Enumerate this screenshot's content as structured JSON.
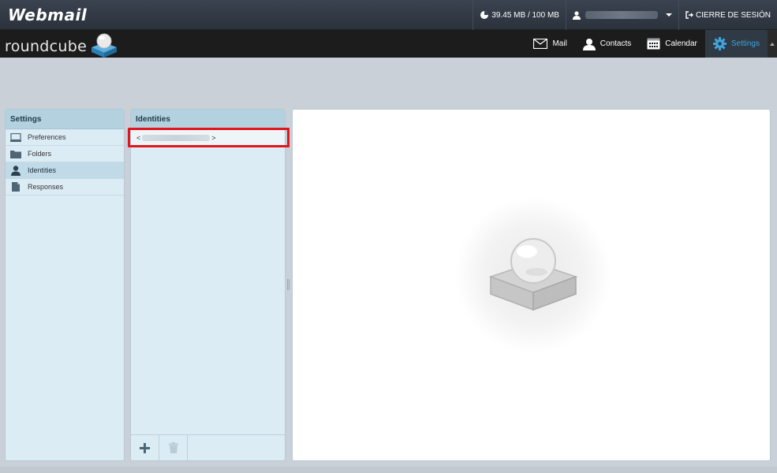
{
  "topbar": {
    "brand": "Webmail",
    "quota": "39.45 MB / 100 MB",
    "logout": "CIERRE DE SESIÓN"
  },
  "header": {
    "logo_text": "roundcube",
    "tasks": [
      {
        "label": "Mail",
        "icon": "mail-icon"
      },
      {
        "label": "Contacts",
        "icon": "contacts-icon"
      },
      {
        "label": "Calendar",
        "icon": "calendar-icon"
      },
      {
        "label": "Settings",
        "icon": "gear-icon",
        "active": true
      }
    ]
  },
  "settings": {
    "title": "Settings",
    "items": [
      {
        "label": "Preferences",
        "icon": "monitor-icon"
      },
      {
        "label": "Folders",
        "icon": "folder-icon"
      },
      {
        "label": "Identities",
        "icon": "user-icon",
        "selected": true
      },
      {
        "label": "Responses",
        "icon": "document-icon"
      }
    ]
  },
  "identities": {
    "title": "Identities",
    "rows": [
      {
        "prefix": "<",
        "suffix": ">"
      }
    ]
  },
  "colors": {
    "accent": "#3fa4dd",
    "highlight": "#e0161d",
    "panel_bg": "#dcecf5",
    "panel_head": "#b3d1df"
  }
}
